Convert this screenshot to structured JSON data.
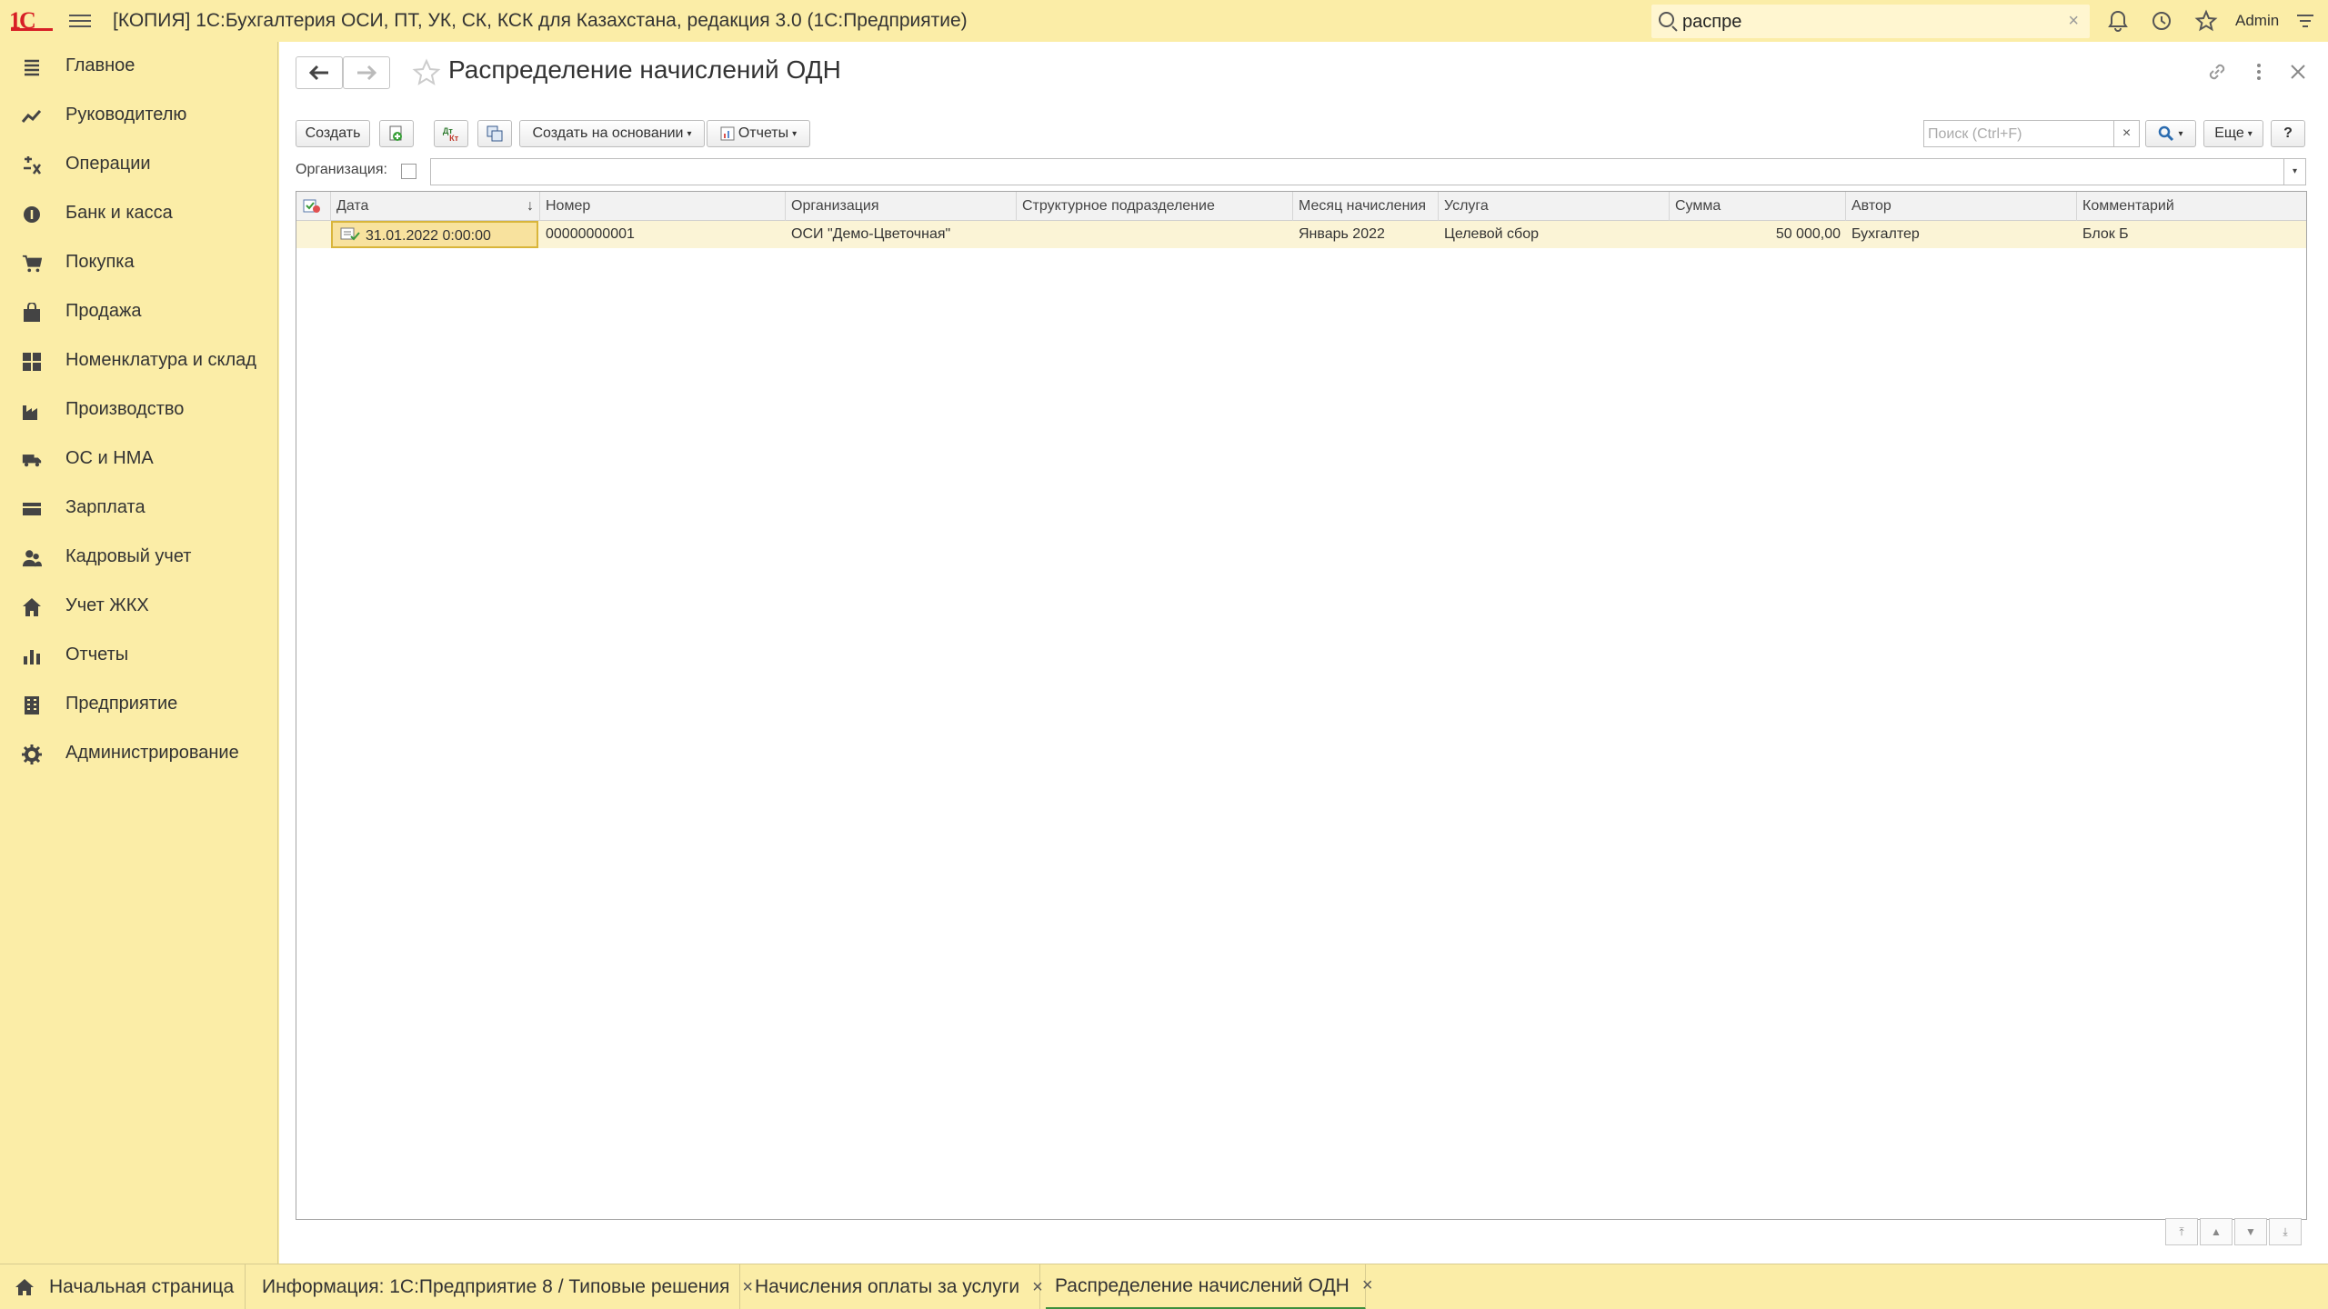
{
  "app": {
    "logo": "1С",
    "title": "[КОПИЯ] 1С:Бухгалтерия ОСИ, ПТ, УК, СК, КСК для Казахстана, редакция 3.0  (1С:Предприятие)",
    "search_value": "распре",
    "user": "Admin"
  },
  "sidebar": {
    "items": [
      {
        "label": "Главное",
        "icon": "menu-lines-icon"
      },
      {
        "label": "Руководителю",
        "icon": "trend-chart-icon"
      },
      {
        "label": "Операции",
        "icon": "operations-icon"
      },
      {
        "label": "Банк и касса",
        "icon": "coins-icon"
      },
      {
        "label": "Покупка",
        "icon": "cart-icon"
      },
      {
        "label": "Продажа",
        "icon": "bag-icon"
      },
      {
        "label": "Номенклатура и склад",
        "icon": "grid-icon"
      },
      {
        "label": "Производство",
        "icon": "factory-icon"
      },
      {
        "label": "ОС и НМА",
        "icon": "truck-icon"
      },
      {
        "label": "Зарплата",
        "icon": "wallet-icon"
      },
      {
        "label": "Кадровый учет",
        "icon": "people-icon"
      },
      {
        "label": "Учет ЖКХ",
        "icon": "house-icon"
      },
      {
        "label": "Отчеты",
        "icon": "bar-chart-icon"
      },
      {
        "label": "Предприятие",
        "icon": "building-icon"
      },
      {
        "label": "Администрирование",
        "icon": "gear-icon"
      }
    ]
  },
  "form": {
    "title": "Распределение начислений ОДН",
    "toolbar": {
      "create": "Создать",
      "create_based": "Создать на основании",
      "reports": "Отчеты",
      "search_placeholder": "Поиск (Ctrl+F)",
      "more": "Еще",
      "help": "?"
    },
    "filter": {
      "org_label": "Организация:"
    },
    "table": {
      "columns": [
        "Дата",
        "Номер",
        "Организация",
        "Структурное подразделение",
        "Месяц начисления",
        "Услуга",
        "Сумма",
        "Автор",
        "Комментарий"
      ],
      "rows": [
        {
          "date": "31.01.2022 0:00:00",
          "number": "00000000001",
          "org": "ОСИ \"Демо-Цветочная\"",
          "department": "",
          "month": "Январь 2022",
          "service": "Целевой сбор",
          "sum": "50 000,00",
          "author": "Бухгалтер",
          "comment": "Блок Б"
        }
      ]
    }
  },
  "tabs": [
    {
      "label": "Начальная страница"
    },
    {
      "label": "Информация: 1С:Предприятие 8 / Типовые решения"
    },
    {
      "label": "Начисления оплаты за услуги"
    },
    {
      "label": "Распределение начислений ОДН"
    }
  ],
  "colors": {
    "background": "#fbeda7",
    "selected_row": "#fbf4d6",
    "active_tab": "#3c8f3c",
    "logo": "#d71f26"
  }
}
